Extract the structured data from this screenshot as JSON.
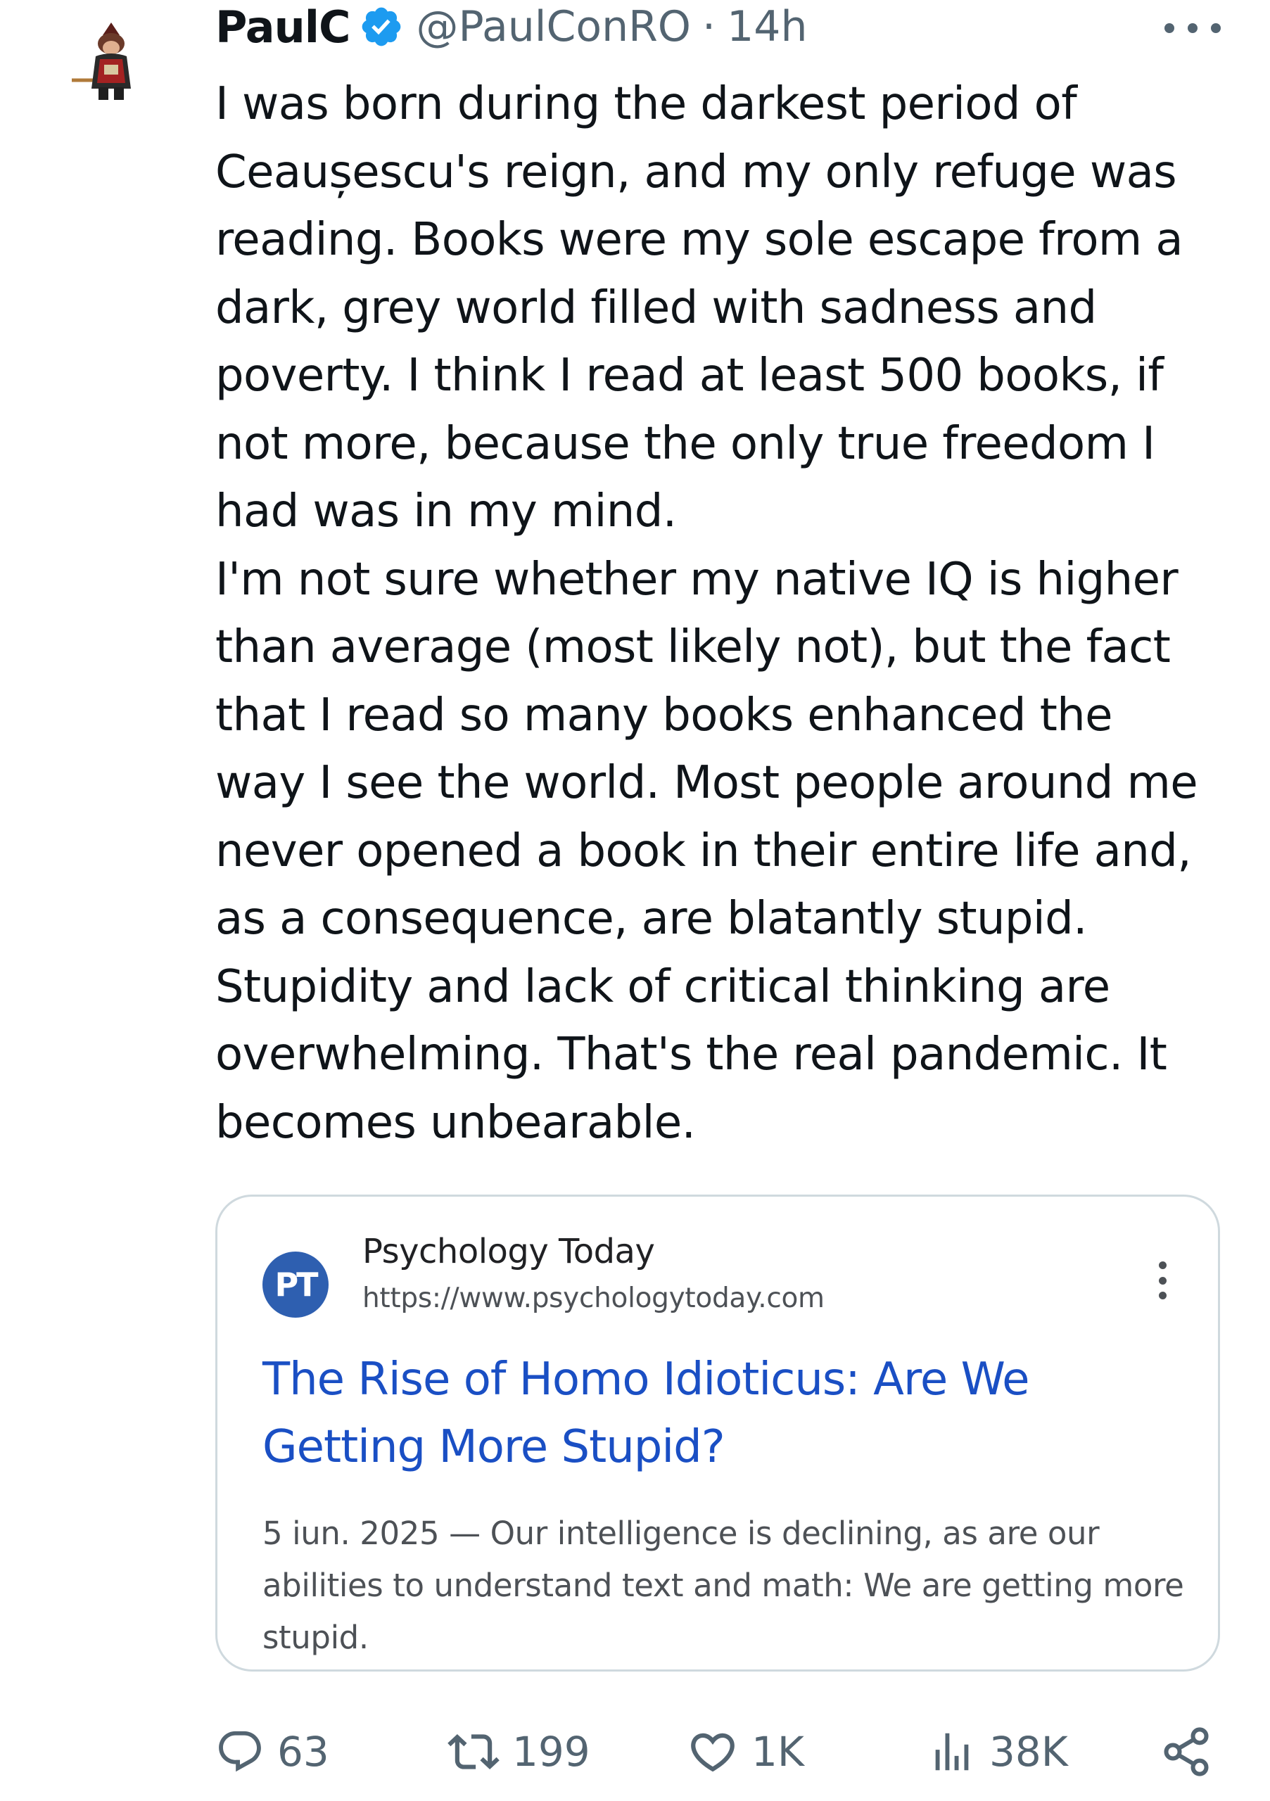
{
  "author": {
    "display_name": "PaulC",
    "handle": "@PaulConRO",
    "separator": "·",
    "timestamp": "14h",
    "verified": true
  },
  "tweet": {
    "text": "I was born during the darkest period of\nCeaușescu's reign, and my only refuge was\nreading. Books were my sole escape from a\ndark, grey world filled with sadness and\npoverty. I think I read at least 500 books, if\nnot more, because the only true freedom I\nhad was in my mind.\nI'm not sure whether my native IQ is higher\nthan average (most likely not), but the fact\nthat I read so many books enhanced the\nway I see the world. Most people around me\nnever opened a book in their entire life and,\nas a consequence, are blatantly stupid.\nStupidity and lack of critical thinking are\noverwhelming. That's the real pandemic. It\nbecomes unbearable."
  },
  "card": {
    "logo_text": "PT",
    "site_name": "Psychology Today",
    "site_url": "https://www.psychologytoday.com",
    "title": "The Rise of Homo Idioticus: Are We Getting More Stupid?",
    "snippet": "5 iun. 2025 — Our intelligence is declining, as are our abilities to understand text and math: We are getting more stupid."
  },
  "actions": {
    "replies": "63",
    "reposts": "199",
    "likes": "1K",
    "views": "38K"
  },
  "colors": {
    "text": "#0f1419",
    "secondary": "#536471",
    "verified_blue": "#1d9bf0",
    "link_blue": "#1a4fc4",
    "card_border": "#cfd9de",
    "pt_logo": "#2e5fb0"
  },
  "icons": {
    "avatar": "avatar-image",
    "verified": "verified-badge-icon",
    "more": "more-horizontal-icon",
    "card_menu": "more-vertical-icon",
    "reply": "reply-icon",
    "repost": "repost-icon",
    "like": "like-heart-icon",
    "views": "views-bar-chart-icon",
    "share": "share-icon"
  }
}
